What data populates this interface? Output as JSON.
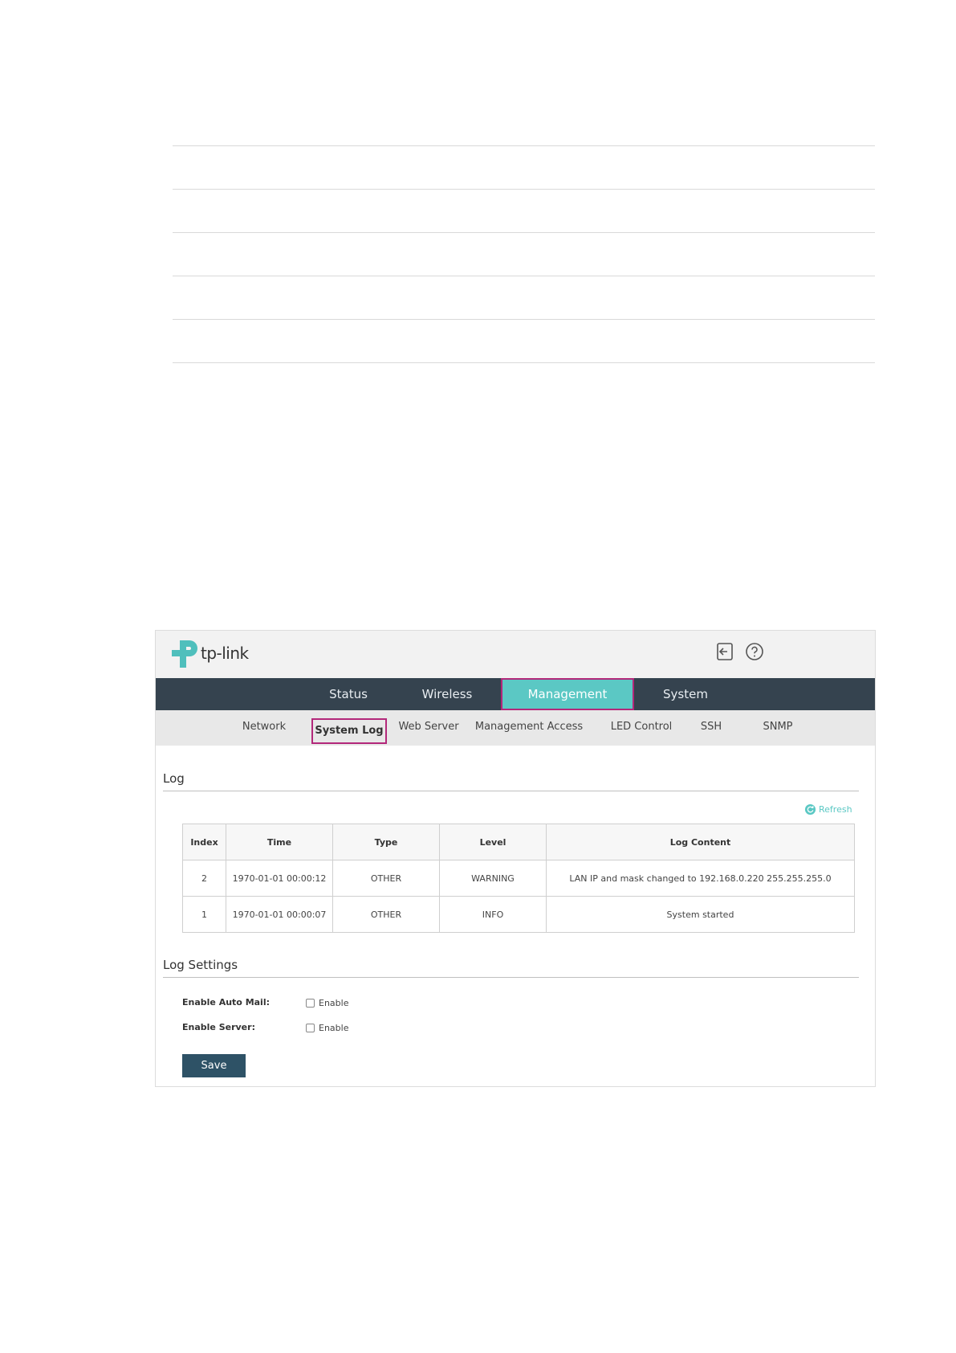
{
  "header": {
    "logo_text": "tp-link"
  },
  "main_nav": [
    {
      "label": "Status"
    },
    {
      "label": "Wireless"
    },
    {
      "label": "Management"
    },
    {
      "label": "System"
    }
  ],
  "sub_nav": [
    {
      "label": "Network"
    },
    {
      "label": "System Log"
    },
    {
      "label": "Web Server"
    },
    {
      "label": "Management Access"
    },
    {
      "label": "LED Control"
    },
    {
      "label": "SSH"
    },
    {
      "label": "SNMP"
    }
  ],
  "log_section": {
    "title": "Log",
    "refresh_label": "Refresh",
    "columns": [
      "Index",
      "Time",
      "Type",
      "Level",
      "Log Content"
    ],
    "rows": [
      [
        "2",
        "1970-01-01 00:00:12",
        "OTHER",
        "WARNING",
        "LAN IP and mask changed to 192.168.0.220 255.255.255.0"
      ],
      [
        "1",
        "1970-01-01 00:00:07",
        "OTHER",
        "INFO",
        "System started"
      ]
    ]
  },
  "log_settings": {
    "title": "Log Settings",
    "auto_mail_label": "Enable Auto Mail:",
    "auto_mail_option": "Enable",
    "server_label": "Enable Server:",
    "server_option": "Enable",
    "save_label": "Save"
  },
  "colors": {
    "nav_bg": "#35434f",
    "active_tab": "#5bc8c4",
    "highlight_border": "#b3287a",
    "save_button": "#2e5266"
  }
}
